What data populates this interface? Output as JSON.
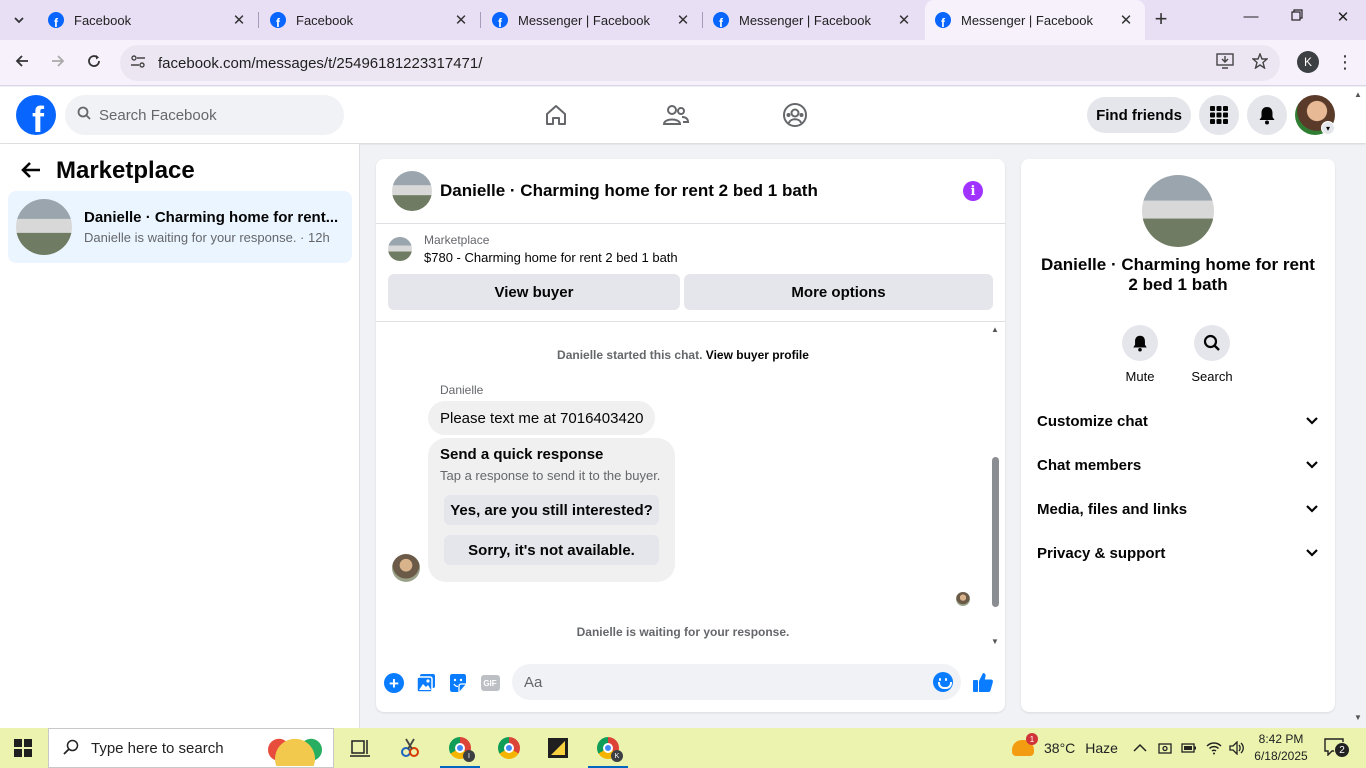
{
  "browser": {
    "tabs": [
      {
        "title": "Facebook"
      },
      {
        "title": "Facebook"
      },
      {
        "title": "Messenger | Facebook"
      },
      {
        "title": "Messenger | Facebook"
      },
      {
        "title": "Messenger | Facebook",
        "active": true
      }
    ],
    "url": "facebook.com/messages/t/25496181223317471/",
    "profile_initial": "K"
  },
  "fb_nav": {
    "search_placeholder": "Search Facebook",
    "find_friends_label": "Find friends"
  },
  "sidebar": {
    "title": "Marketplace",
    "conversations": [
      {
        "name": "Danielle · Charming home for rent...",
        "preview": "Danielle is waiting for your response. · 12h",
        "selected": true
      }
    ]
  },
  "chat": {
    "title": "Danielle · Charming home for rent 2 bed 1 bath",
    "marketplace_label": "Marketplace",
    "listing": "$780 - Charming home for rent 2 bed 1 bath",
    "view_buyer_label": "View buyer",
    "more_options_label": "More options",
    "started_text": "Danielle started this chat.",
    "view_buyer_profile_link": "View buyer profile",
    "sender_name": "Danielle",
    "message": "Please text me at 7016403420",
    "quick_response": {
      "title": "Send a quick response",
      "subtitle": "Tap a response to send it to the buyer.",
      "options": [
        "Yes, are you still interested?",
        "Sorry, it's not available."
      ]
    },
    "waiting_text": "Danielle is waiting for your response.",
    "composer_placeholder": "Aa"
  },
  "info_pane": {
    "title": "Danielle · Charming home for rent 2 bed 1 bath",
    "actions": [
      {
        "label": "Mute",
        "icon": "bell-icon"
      },
      {
        "label": "Search",
        "icon": "search-icon"
      }
    ],
    "sections": [
      "Customize chat",
      "Chat members",
      "Media, files and links",
      "Privacy & support"
    ]
  },
  "taskbar": {
    "search_placeholder": "Type here to search",
    "weather": {
      "temp": "38°C",
      "condition": "Haze",
      "badge": "1"
    },
    "time": "8:42 PM",
    "date": "6/18/2025",
    "notification_count": "2",
    "chrome_badge_i": "I",
    "chrome_badge_k": "K"
  },
  "colors": {
    "fb_blue": "#0866ff",
    "messenger_blue": "#0a7cff",
    "info_purple": "#a033ff",
    "selected_conv_bg": "#ebf5ff",
    "taskbar_bg": "#ebf3ae",
    "tabstrip_bg": "#e8dff5"
  }
}
